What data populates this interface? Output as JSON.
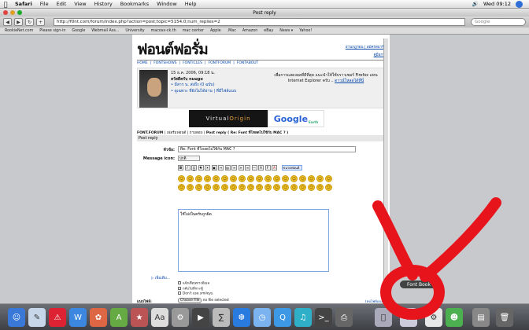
{
  "menubar": {
    "app": "Safari",
    "items": [
      "File",
      "Edit",
      "View",
      "History",
      "Bookmarks",
      "Window",
      "Help"
    ],
    "clock": "Wed 09:12"
  },
  "window": {
    "title": "Post reply",
    "url": "http://f0nt.com/forum/index.php?action=post;topic=5154.0;num_replies=2",
    "search_placeholder": "Google",
    "bookmarks": [
      "RookieNet.com",
      "Please sign-in",
      "Google",
      "Webmail Ass...",
      "University",
      "macosx-ck.th",
      "mac center",
      "Apple",
      ".Mac",
      "Amazon",
      "eBay",
      "News ▾",
      "Yahoo!"
    ]
  },
  "forum": {
    "logo": "ฟอนต์ฟอรั่ม",
    "top_link": "อ่านกฎก่อน | สมัครสมาชิก",
    "reg_link": "คู่มือการ",
    "nav": [
      "HOME",
      "FONTSHOWS",
      "FONTICLES",
      "FONTFORUM",
      "FONTABOUT"
    ],
    "user": {
      "date": "15 ธ.ค. 2006, 09:18 น.",
      "greeting": "สวัสดีครับ nuugo",
      "line2": "• มีสาร น. ส่งถึง (0 ฉบับ)",
      "line3": "• ดูเฉพาะ ที่ยังไม่ได้อ่าน | ที่มีไฟล์แนบ"
    },
    "notice": "เพื่อการแสดงผลที่ดีที่สุด แนะนำให้ใช้บราวเซอร์ Firefox แทน Internet Explorer ครับ ..",
    "notice_link": "ดาวน์โหลดได้ที่นี่",
    "banner_left": "Virtual",
    "banner_right": "Origin",
    "google": "Google",
    "google_sub": "Earth",
    "crumb_home": "FONT.FORUM",
    "crumb_mid": "เฟอร์มฟอนต์",
    "crumb_cat": "ถามตอบ",
    "crumb_last": "Post reply ( Re: Font ที่โหลดไปใช้กับ MAC ? )",
    "section": "Post reply",
    "subject_label": "หัวข้อ:",
    "subject_value": "Re: Font ที่โหลดไปใช้กับ MAC ?",
    "icon_label": "Message icon:",
    "icon_value": "ปกติ",
    "font_select": "ขนาดฟอนต์",
    "message": "ใช้ไม่เป็นครับถูกผิด",
    "more_link": "▷ เพิ่มเติม...",
    "options": [
      "แจ้งเตือนทางอีเมล",
      "กลับไปที่กระทู้",
      "Don't use smileys."
    ],
    "attach_label": "แนบไฟล์:",
    "choose_btn": "Choose File",
    "no_file": "no file selected",
    "right_link": "(ลบไฟล์แนบ)"
  },
  "dock": {
    "tooltip": "Font Book"
  },
  "colors": {
    "accent": "#0044aa",
    "annotation": "#e8141c"
  }
}
